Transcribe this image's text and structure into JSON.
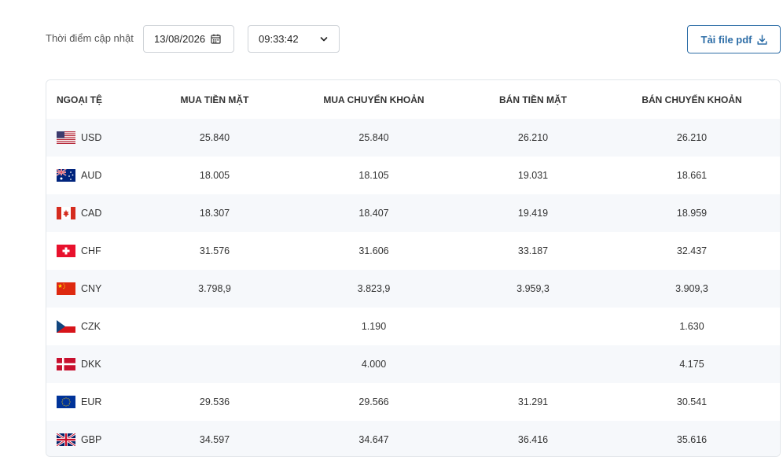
{
  "toolbar": {
    "update_label": "Thời điểm cập nhật",
    "date": "13/08/2026",
    "time": "09:33:42",
    "pdf_label": "Tải file pdf"
  },
  "table": {
    "headers": [
      "NGOẠI TỆ",
      "MUA TIỀN MẶT",
      "MUA CHUYỂN KHOẢN",
      "BÁN TIỀN MẶT",
      "BÁN CHUYỂN KHOẢN"
    ],
    "rows": [
      {
        "code": "USD",
        "flag": "us-flag-icon",
        "cash_buy": "25.840",
        "transfer_buy": "25.840",
        "cash_sell": "26.210",
        "transfer_sell": "26.210"
      },
      {
        "code": "AUD",
        "flag": "au-flag-icon",
        "cash_buy": "18.005",
        "transfer_buy": "18.105",
        "cash_sell": "19.031",
        "transfer_sell": "18.661"
      },
      {
        "code": "CAD",
        "flag": "ca-flag-icon",
        "cash_buy": "18.307",
        "transfer_buy": "18.407",
        "cash_sell": "19.419",
        "transfer_sell": "18.959"
      },
      {
        "code": "CHF",
        "flag": "ch-flag-icon",
        "cash_buy": "31.576",
        "transfer_buy": "31.606",
        "cash_sell": "33.187",
        "transfer_sell": "32.437"
      },
      {
        "code": "CNY",
        "flag": "cn-flag-icon",
        "cash_buy": "3.798,9",
        "transfer_buy": "3.823,9",
        "cash_sell": "3.959,3",
        "transfer_sell": "3.909,3"
      },
      {
        "code": "CZK",
        "flag": "cz-flag-icon",
        "cash_buy": "",
        "transfer_buy": "1.190",
        "cash_sell": "",
        "transfer_sell": "1.630"
      },
      {
        "code": "DKK",
        "flag": "dk-flag-icon",
        "cash_buy": "",
        "transfer_buy": "4.000",
        "cash_sell": "",
        "transfer_sell": "4.175"
      },
      {
        "code": "EUR",
        "flag": "eu-flag-icon",
        "cash_buy": "29.536",
        "transfer_buy": "29.566",
        "cash_sell": "31.291",
        "transfer_sell": "30.541"
      },
      {
        "code": "GBP",
        "flag": "gb-flag-icon",
        "cash_buy": "34.597",
        "transfer_buy": "34.647",
        "cash_sell": "36.416",
        "transfer_sell": "35.616"
      }
    ]
  },
  "colors": {
    "accent": "#2e6ea7",
    "row_stripe": "#f6f8fb",
    "border": "#cfd3d8"
  }
}
